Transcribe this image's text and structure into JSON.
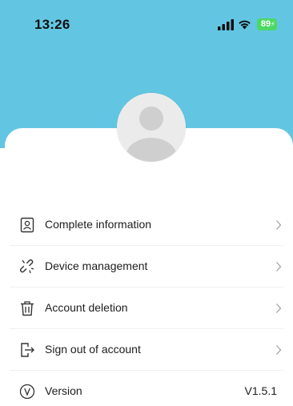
{
  "status_bar": {
    "time": "13:26",
    "battery": "89",
    "icons": [
      "signal-icon",
      "wifi-icon",
      "battery-icon"
    ]
  },
  "colors": {
    "header": "#62c6e2",
    "battery": "#4cd964",
    "text": "#1d1d1d"
  },
  "profile": {
    "avatar_icon": "user-avatar-icon"
  },
  "menu": {
    "items": [
      {
        "label": "Complete information",
        "icon": "id-card-icon"
      },
      {
        "label": "Device management",
        "icon": "unlink-icon"
      },
      {
        "label": "Account deletion",
        "icon": "trash-icon"
      },
      {
        "label": "Sign out of account",
        "icon": "logout-icon"
      },
      {
        "label": "Version",
        "icon": "version-icon",
        "value": "V1.5.1"
      }
    ]
  }
}
